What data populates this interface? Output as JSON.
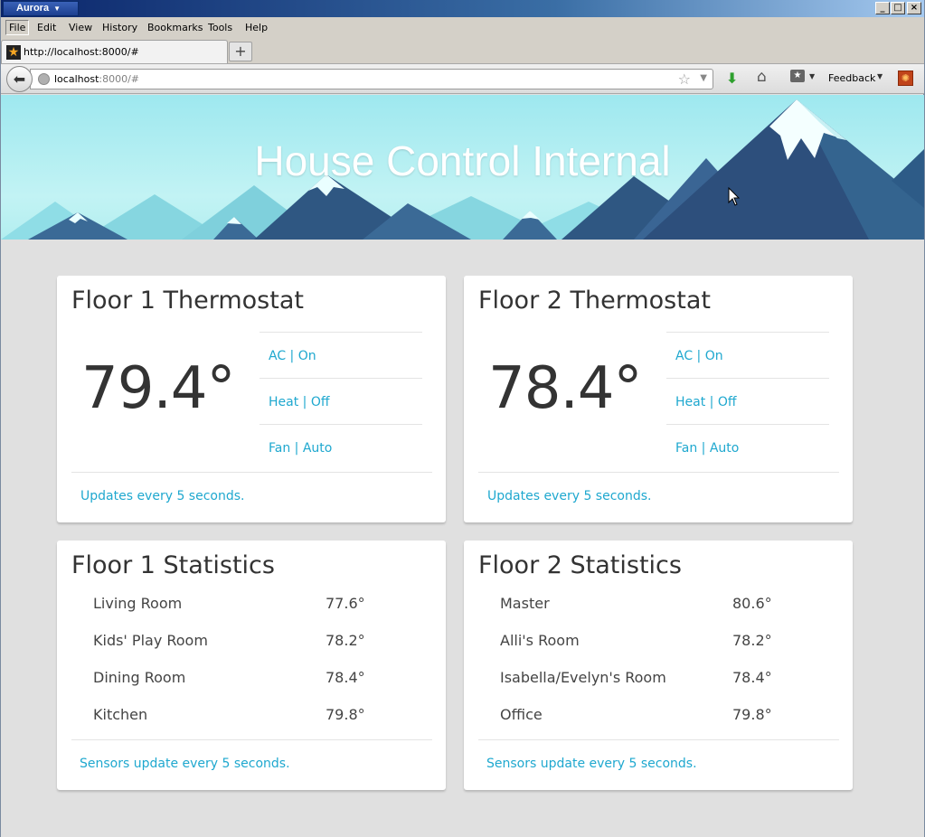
{
  "browser": {
    "app_name": "Aurora",
    "window_controls": {
      "minimize": "_",
      "maximize": "□",
      "close": "×"
    },
    "menu": [
      "File",
      "Edit",
      "View",
      "History",
      "Bookmarks",
      "Tools",
      "Help"
    ],
    "tab": {
      "title": "http://localhost:8000/#"
    },
    "url": {
      "host": "localhost",
      "rest": ":8000/#"
    },
    "feedback_label": "Feedback"
  },
  "page": {
    "banner_title": "House Control Internal",
    "thermostats": [
      {
        "title": "Floor 1 Thermostat",
        "temperature": "79.4°",
        "modes": [
          "AC | On",
          "Heat | Off",
          "Fan | Auto"
        ],
        "note": "Updates every 5 seconds."
      },
      {
        "title": "Floor 2 Thermostat",
        "temperature": "78.4°",
        "modes": [
          "AC | On",
          "Heat | Off",
          "Fan | Auto"
        ],
        "note": "Updates every 5 seconds."
      }
    ],
    "statistics": [
      {
        "title": "Floor 1 Statistics",
        "rooms": [
          {
            "name": "Living Room",
            "temp": "77.6°"
          },
          {
            "name": "Kids' Play Room",
            "temp": "78.2°"
          },
          {
            "name": "Dining Room",
            "temp": "78.4°"
          },
          {
            "name": "Kitchen",
            "temp": "79.8°"
          }
        ],
        "note": "Sensors update every 5 seconds."
      },
      {
        "title": "Floor 2 Statistics",
        "rooms": [
          {
            "name": "Master",
            "temp": "80.6°"
          },
          {
            "name": "Alli's Room",
            "temp": "78.2°"
          },
          {
            "name": "Isabella/Evelyn's Room",
            "temp": "78.4°"
          },
          {
            "name": "Office",
            "temp": "79.8°"
          }
        ],
        "note": "Sensors update every 5 seconds."
      }
    ]
  },
  "colors": {
    "accent": "#1fa8cf",
    "page_bg": "#e0e0e0",
    "banner_sky": "#9ee8ef",
    "mountain_dark": "#2d4f7c"
  }
}
